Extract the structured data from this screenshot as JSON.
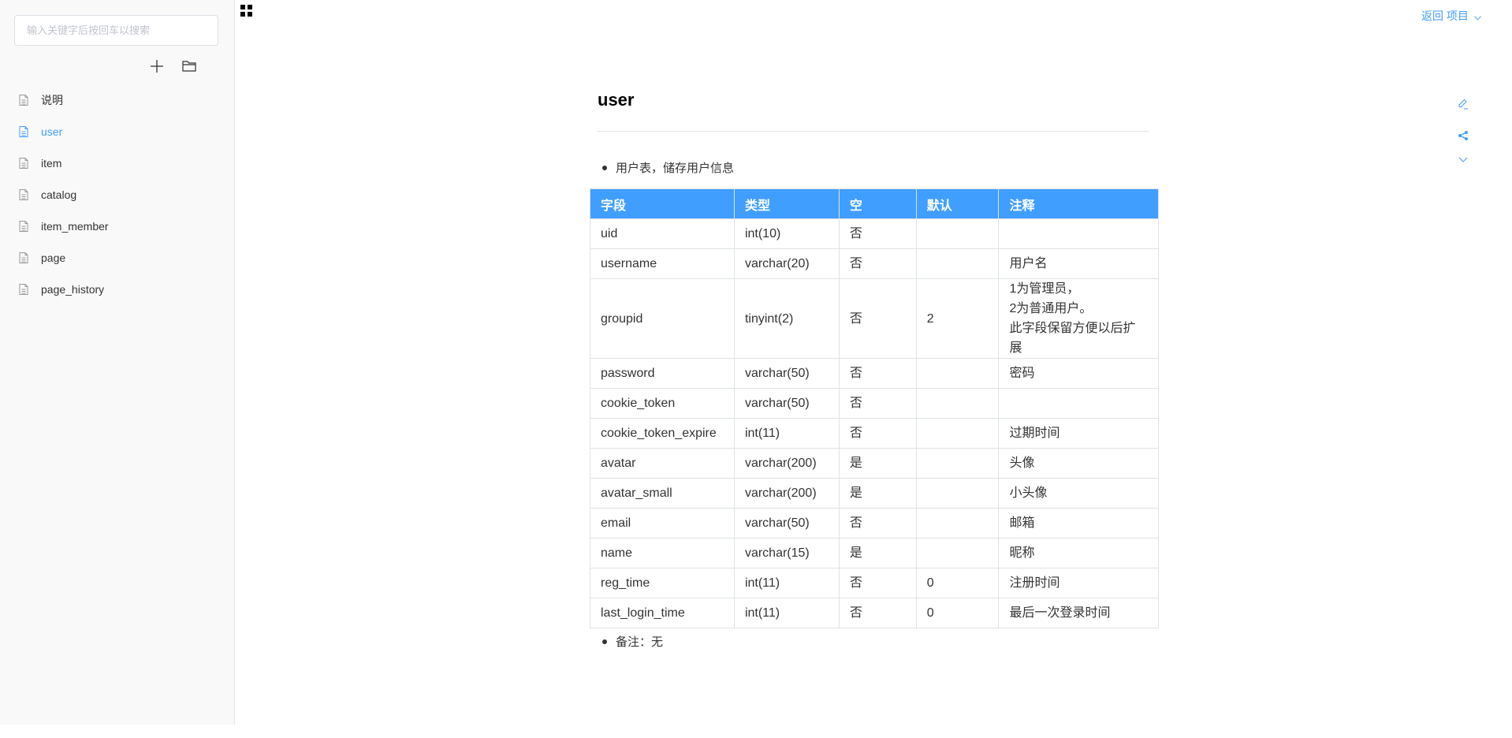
{
  "sidebar": {
    "search_placeholder": "输入关键字后按回车以搜索",
    "search_value": "",
    "tools": {
      "add_icon": "plus-icon",
      "folder_icon": "folder-icon"
    },
    "items": [
      {
        "label": "说明",
        "active": false
      },
      {
        "label": "user",
        "active": true
      },
      {
        "label": "item",
        "active": false
      },
      {
        "label": "catalog",
        "active": false
      },
      {
        "label": "item_member",
        "active": false
      },
      {
        "label": "page",
        "active": false
      },
      {
        "label": "page_history",
        "active": false
      }
    ]
  },
  "header": {
    "grid_icon": "grid-icon",
    "back_link": "返回 项目",
    "right_tools": [
      "edit-icon",
      "share-icon",
      "chevron-down-icon"
    ]
  },
  "page": {
    "title": "user",
    "description": "用户表，储存用户信息",
    "note": "备注：无",
    "table": {
      "columns": [
        "字段",
        "类型",
        "空",
        "默认",
        "注释"
      ],
      "rows": [
        [
          "uid",
          "int(10)",
          "否",
          "",
          ""
        ],
        [
          "username",
          "varchar(20)",
          "否",
          "",
          "用户名"
        ],
        [
          "groupid",
          "tinyint(2)",
          "否",
          "2",
          "1为管理员，\n2为普通用户。\n此字段保留方便以后扩展"
        ],
        [
          "password",
          "varchar(50)",
          "否",
          "",
          "密码"
        ],
        [
          "cookie_token",
          "varchar(50)",
          "否",
          "",
          ""
        ],
        [
          "cookie_token_expire",
          "int(11)",
          "否",
          "",
          "过期时间"
        ],
        [
          "avatar",
          "varchar(200)",
          "是",
          "",
          "头像"
        ],
        [
          "avatar_small",
          "varchar(200)",
          "是",
          "",
          "小头像"
        ],
        [
          "email",
          "varchar(50)",
          "否",
          "",
          "邮箱"
        ],
        [
          "name",
          "varchar(15)",
          "是",
          "",
          "昵称"
        ],
        [
          "reg_time",
          "int(11)",
          "否",
          "0",
          "注册时间"
        ],
        [
          "last_login_time",
          "int(11)",
          "否",
          "0",
          "最后一次登录时间"
        ]
      ]
    }
  },
  "colors": {
    "accent": "#409eff",
    "sidebar_bg": "#f9f9f9",
    "border": "#dfe2e5"
  }
}
